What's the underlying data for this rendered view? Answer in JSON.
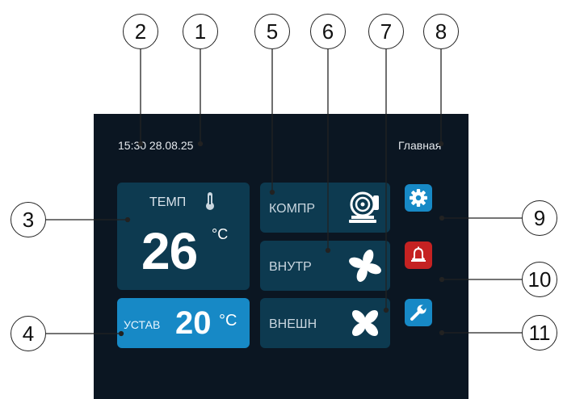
{
  "header": {
    "time": "15:30 28.08.25",
    "screen_title": "Главная"
  },
  "temperature": {
    "label": "ТЕМП",
    "value": "26",
    "unit": "°C",
    "icon": "thermometer-icon"
  },
  "setpoint": {
    "label": "УСТАВ",
    "value": "20",
    "unit": "°C"
  },
  "modes": [
    {
      "label": "КОМПР",
      "icon": "compressor-icon"
    },
    {
      "label": "ВНУТР",
      "icon": "fan-icon"
    },
    {
      "label": "ВНЕШН",
      "icon": "fan-icon"
    }
  ],
  "buttons": [
    {
      "icon": "gear-icon",
      "color": "#1789c6"
    },
    {
      "icon": "bell-icon",
      "color": "#c52222"
    },
    {
      "icon": "wrench-icon",
      "color": "#1789c6"
    }
  ],
  "callouts": [
    "1",
    "2",
    "3",
    "4",
    "5",
    "6",
    "7",
    "8",
    "9",
    "10",
    "11"
  ],
  "colors": {
    "background": "#0b1622",
    "tile": "#0d3a50",
    "accent": "#1789c6",
    "alarm": "#c52222"
  }
}
